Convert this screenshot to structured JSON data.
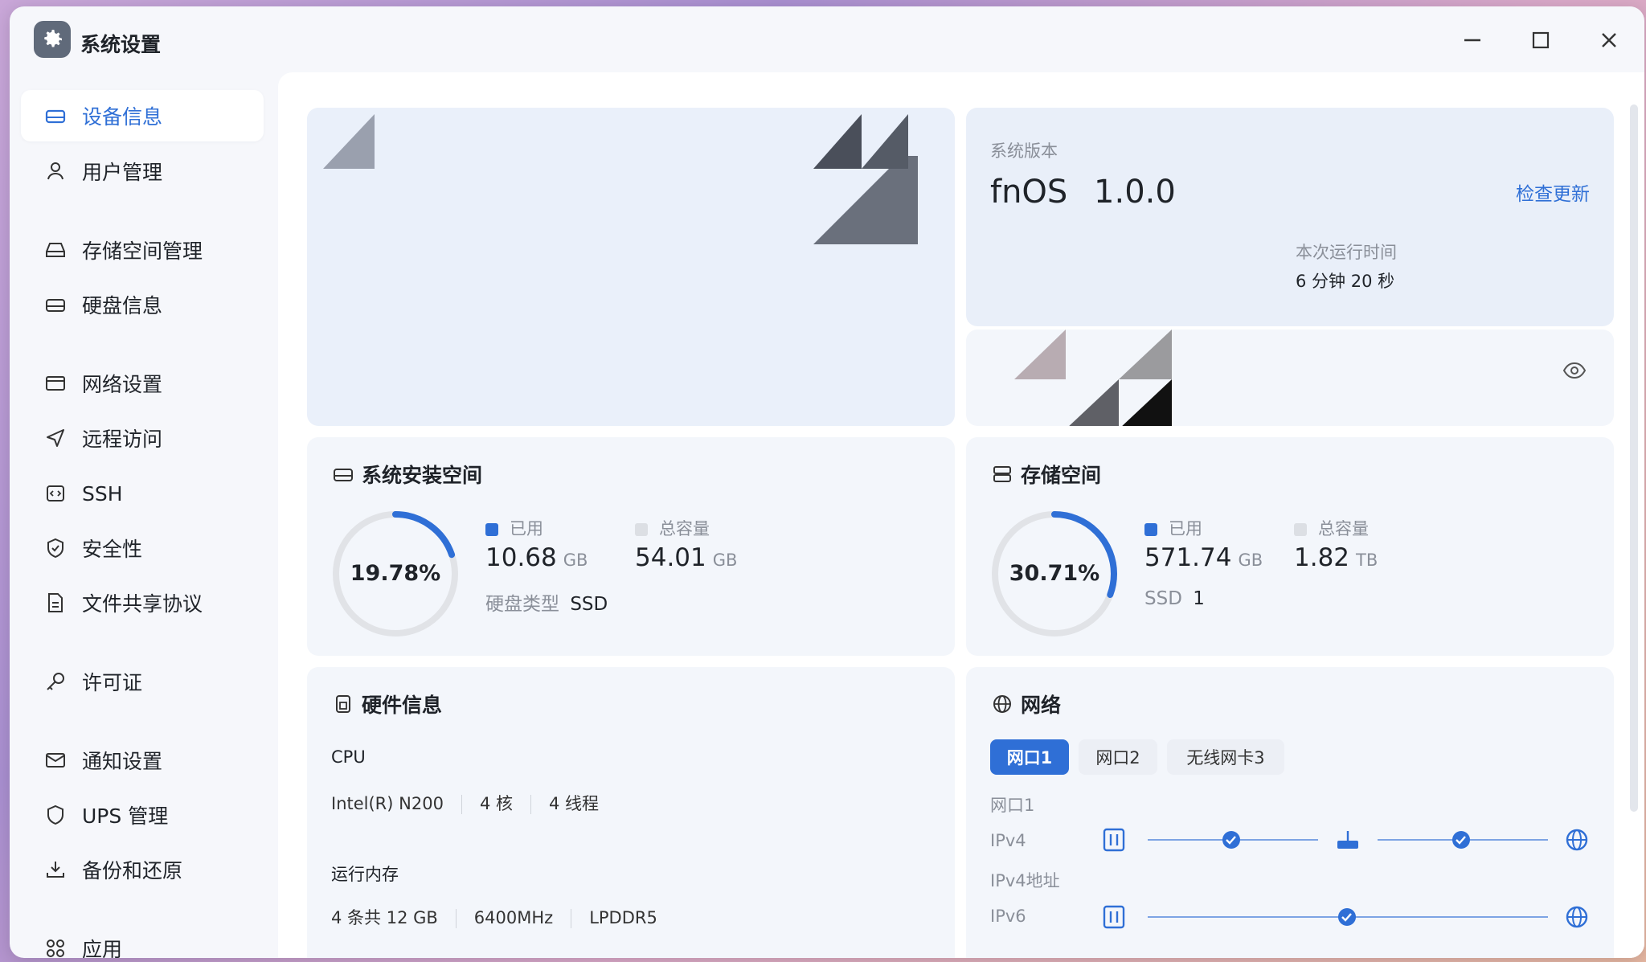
{
  "window": {
    "title": "系统设置"
  },
  "sidebar": {
    "items": [
      {
        "label": "设备信息",
        "icon": "device-icon",
        "active": true
      },
      {
        "label": "用户管理",
        "icon": "user-icon"
      },
      {
        "label": "存储空间管理",
        "icon": "storage-icon"
      },
      {
        "label": "硬盘信息",
        "icon": "disk-icon"
      },
      {
        "label": "网络设置",
        "icon": "network-icon"
      },
      {
        "label": "远程访问",
        "icon": "send-icon"
      },
      {
        "label": "SSH",
        "icon": "ssh-icon"
      },
      {
        "label": "安全性",
        "icon": "shield-check-icon"
      },
      {
        "label": "文件共享协议",
        "icon": "file-icon"
      },
      {
        "label": "许可证",
        "icon": "key-icon"
      },
      {
        "label": "通知设置",
        "icon": "mail-icon"
      },
      {
        "label": "UPS 管理",
        "icon": "ups-shield-icon"
      },
      {
        "label": "备份和还原",
        "icon": "backup-icon"
      },
      {
        "label": "应用",
        "icon": "apps-icon"
      }
    ]
  },
  "system": {
    "version_label": "系统版本",
    "os_name": "fnOS",
    "version": "1.0.0",
    "check_update": "检查更新",
    "uptime_label": "本次运行时间",
    "uptime_value": "6 分钟 20 秒"
  },
  "install_space": {
    "title": "系统安装空间",
    "percent_text": "19.78%",
    "percent": 19.78,
    "used_label": "已用",
    "used_value": "10.68",
    "used_unit": "GB",
    "total_label": "总容量",
    "total_value": "54.01",
    "total_unit": "GB",
    "disk_type_label": "硬盘类型",
    "disk_type_value": "SSD"
  },
  "storage_space": {
    "title": "存储空间",
    "percent_text": "30.71%",
    "percent": 30.71,
    "used_label": "已用",
    "used_value": "571.74",
    "used_unit": "GB",
    "total_label": "总容量",
    "total_value": "1.82",
    "total_unit": "TB",
    "ssd_label": "SSD",
    "ssd_count": "1"
  },
  "hardware": {
    "title": "硬件信息",
    "cpu_label": "CPU",
    "cpu_model": "Intel(R) N200",
    "cpu_cores": "4 核",
    "cpu_threads": "4 线程",
    "mem_label": "运行内存",
    "mem_size": "4 条共 12 GB",
    "mem_speed": "6400MHz",
    "mem_type": "LPDDR5"
  },
  "network": {
    "title": "网络",
    "tabs": [
      "网口1",
      "网口2",
      "无线网卡3"
    ],
    "active_tab": "网口1",
    "port_label": "网口1",
    "ipv4_label": "IPv4",
    "ipv4_addr_label": "IPv4地址",
    "ipv6_label": "IPv6"
  },
  "colors": {
    "accent": "#2f6fd6",
    "ring_track": "#e1e3e7",
    "legend_total": "#dcdfe4",
    "card_bg": "#f3f6fb"
  }
}
